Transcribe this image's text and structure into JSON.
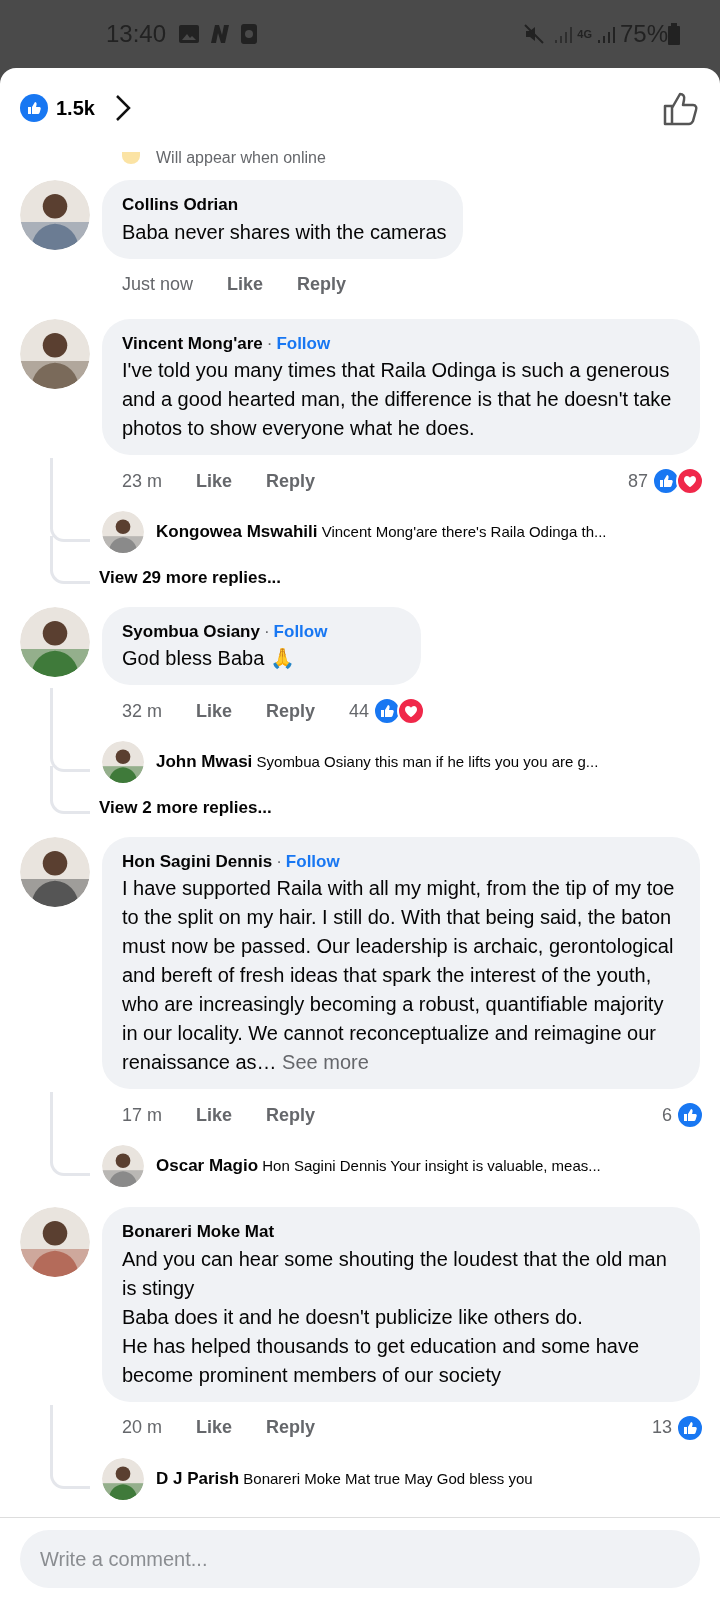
{
  "status_bar": {
    "time": "13:40",
    "network": "4G",
    "battery": "75%"
  },
  "header": {
    "like_count": "1.5k"
  },
  "notice": {
    "text": "Will appear when online"
  },
  "comments": [
    {
      "author": "Collins Odrian",
      "text": "Baba never shares with the cameras",
      "time": "Just now",
      "like": "Like",
      "reply": "Reply"
    },
    {
      "author": "Vincent Mong'are",
      "separator": "·",
      "follow": "Follow",
      "text": "I've told you many times that Raila Odinga is such a generous and a good hearted man, the difference is that he doesn't take photos to show everyone what he does.",
      "time": "23 m",
      "like": "Like",
      "reply": "Reply",
      "reaction_count": "87",
      "reactions": [
        {
          "kind": "like"
        },
        {
          "kind": "love"
        }
      ],
      "replies": [
        {
          "author": "Kongowea Mswahili",
          "text": "Vincent Mong'are there's Raila Odinga th..."
        }
      ],
      "more_replies": "View 29 more replies..."
    },
    {
      "author": "Syombua Osiany",
      "separator": "·",
      "follow": "Follow",
      "text": "God bless Baba 🙏",
      "time": "32 m",
      "like": "Like",
      "reply": "Reply",
      "reaction_count": "44",
      "reactions": [
        {
          "kind": "like"
        },
        {
          "kind": "love"
        }
      ],
      "replies": [
        {
          "author": "John Mwasi",
          "text": "Syombua Osiany this man if he lifts you you are g..."
        }
      ],
      "more_replies": "View 2 more replies..."
    },
    {
      "author": "Hon Sagini Dennis",
      "separator": "·",
      "follow": "Follow",
      "text": "I have supported Raila with all my might, from the tip of my toe to the split  on my hair. I still do. With that being said, the baton must now be passed. Our leadership is archaic, gerontological and bereft of fresh ideas that spark the interest of the youth, who are increasingly becoming a robust, quantifiable majority  in our locality. We cannot reconceptualize and reimagine our renaissance as…",
      "see_more": "See more",
      "time": "17 m",
      "like": "Like",
      "reply": "Reply",
      "reaction_count": "6",
      "reactions": [
        {
          "kind": "like"
        }
      ],
      "replies": [
        {
          "author": "Oscar Magio",
          "text": "Hon Sagini Dennis Your insight is valuable, meas..."
        }
      ]
    },
    {
      "author": "Bonareri Moke Mat",
      "text": "And you can hear some shouting the loudest that the old man is stingy\nBaba does it and he doesn't publicize like others do.\nHe has helped thousands to get education and some have become prominent members of our society",
      "time": "20 m",
      "like": "Like",
      "reply": "Reply",
      "reaction_count": "13",
      "reactions": [
        {
          "kind": "like"
        }
      ],
      "replies": [
        {
          "author": "D J Parish",
          "text": "Bonareri Moke Mat true May God bless you"
        }
      ]
    }
  ],
  "composer": {
    "placeholder": "Write a comment..."
  }
}
